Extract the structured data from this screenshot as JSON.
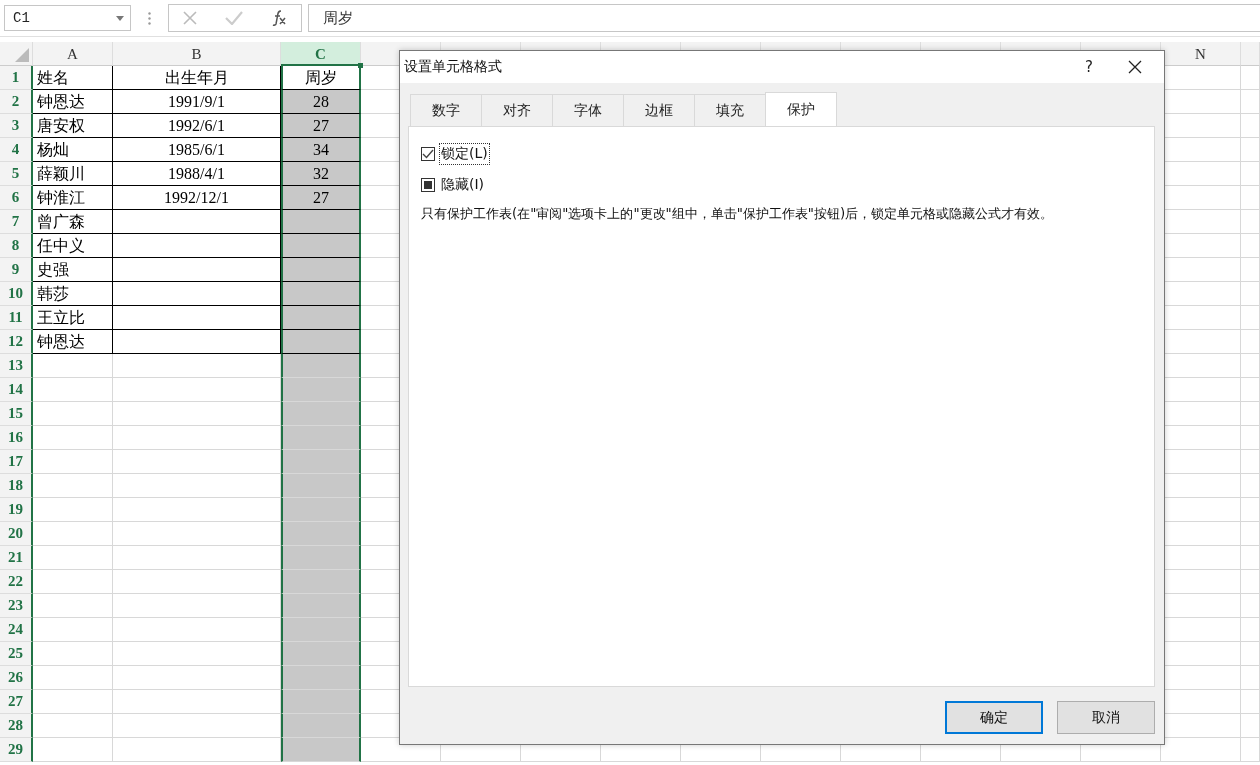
{
  "formula_bar": {
    "name_box": "C1",
    "formula": "周岁"
  },
  "columns": [
    {
      "label": "A",
      "selected": false
    },
    {
      "label": "B",
      "selected": false
    },
    {
      "label": "C",
      "selected": true
    },
    {
      "selected": false
    },
    {
      "selected": false
    },
    {
      "selected": false
    },
    {
      "selected": false
    },
    {
      "selected": false
    },
    {
      "selected": false
    },
    {
      "selected": false
    },
    {
      "selected": false
    },
    {
      "selected": false
    },
    {
      "selected": false
    },
    {
      "label": "N",
      "selected": false
    }
  ],
  "rows": [
    {
      "number": "1",
      "cells": [
        "姓名",
        "出生年月",
        "周岁"
      ]
    },
    {
      "number": "2",
      "cells": [
        "钟恩达",
        "1991/9/1",
        "28"
      ]
    },
    {
      "number": "3",
      "cells": [
        "唐安权",
        "1992/6/1",
        "27"
      ]
    },
    {
      "number": "4",
      "cells": [
        "杨灿",
        "1985/6/1",
        "34"
      ]
    },
    {
      "number": "5",
      "cells": [
        "薛颖川",
        "1988/4/1",
        "32"
      ]
    },
    {
      "number": "6",
      "cells": [
        "钟淮江",
        "1992/12/1",
        "27"
      ]
    },
    {
      "number": "7",
      "cells": [
        "曾广森",
        null,
        null
      ]
    },
    {
      "number": "8",
      "cells": [
        "任中义",
        null,
        null
      ]
    },
    {
      "number": "9",
      "cells": [
        "史强",
        null,
        null
      ]
    },
    {
      "number": "10",
      "cells": [
        "韩莎",
        null,
        null
      ]
    },
    {
      "number": "11",
      "cells": [
        "王立比",
        null,
        null
      ]
    },
    {
      "number": "12",
      "cells": [
        "钟恩达",
        null,
        null
      ]
    },
    {
      "number": "13",
      "cells": []
    },
    {
      "number": "14",
      "cells": []
    },
    {
      "number": "15",
      "cells": []
    },
    {
      "number": "16",
      "cells": []
    },
    {
      "number": "17",
      "cells": []
    },
    {
      "number": "18",
      "cells": []
    },
    {
      "number": "19",
      "cells": []
    },
    {
      "number": "20",
      "cells": []
    },
    {
      "number": "21",
      "cells": []
    },
    {
      "number": "22",
      "cells": []
    },
    {
      "number": "23",
      "cells": []
    },
    {
      "number": "24",
      "cells": []
    },
    {
      "number": "25",
      "cells": []
    },
    {
      "number": "26",
      "cells": []
    },
    {
      "number": "27",
      "cells": []
    },
    {
      "number": "28",
      "cells": []
    },
    {
      "number": "29",
      "cells": []
    }
  ],
  "dialog": {
    "title": "设置单元格格式",
    "help": "?",
    "tabs": [
      {
        "label": "数字",
        "selected": false
      },
      {
        "label": "对齐",
        "selected": false
      },
      {
        "label": "字体",
        "selected": false
      },
      {
        "label": "边框",
        "selected": false
      },
      {
        "label": "填充",
        "selected": false
      },
      {
        "label": "保护",
        "selected": true
      }
    ],
    "options": [
      {
        "label": "锁定(L)",
        "checked": true,
        "mixed": false,
        "focused": true
      },
      {
        "label": "隐藏(I)",
        "checked": false,
        "mixed": true,
        "focused": false
      }
    ],
    "note": "只有保护工作表(在\"审阅\"选项卡上的\"更改\"组中，单击\"保护工作表\"按钮)后，锁定单元格或隐藏公式才有效。",
    "buttons": [
      {
        "label": "确定",
        "default": true
      },
      {
        "label": "取消",
        "default": false
      }
    ]
  }
}
